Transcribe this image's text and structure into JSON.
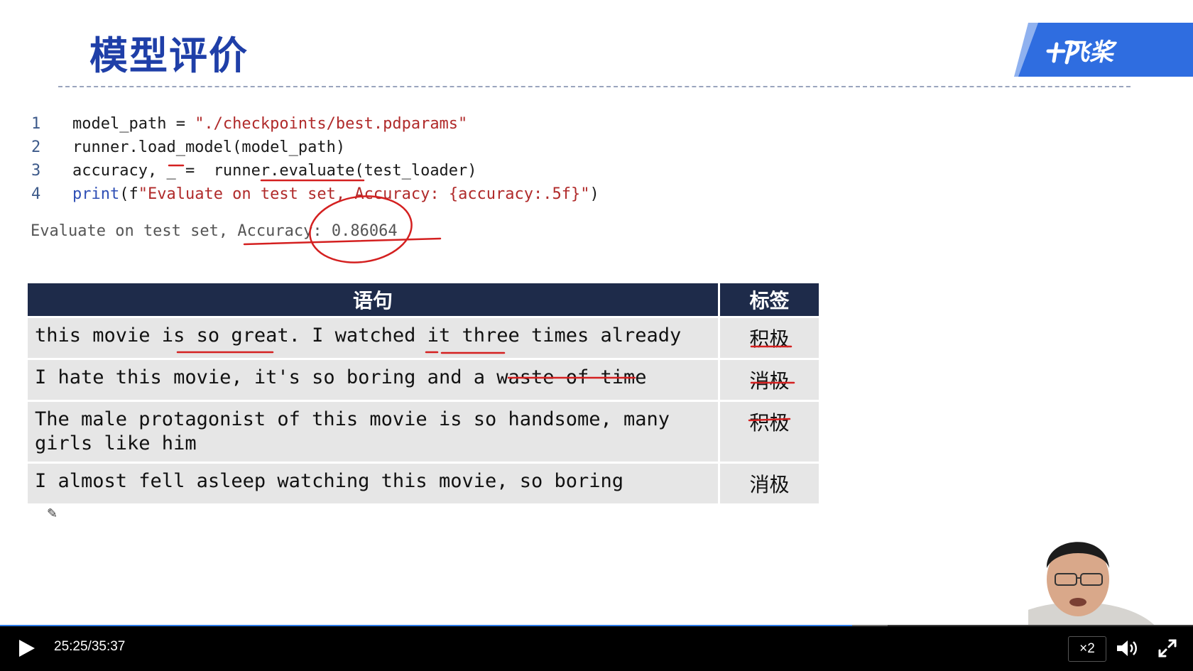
{
  "slide": {
    "title": "模型评价",
    "logo_text": "飞桨",
    "code": [
      {
        "num": "1",
        "parts": [
          {
            "t": "model_path = ",
            "c": "code-text"
          },
          {
            "t": "\"./checkpoints/best.pdparams\"",
            "c": "str"
          }
        ]
      },
      {
        "num": "2",
        "parts": [
          {
            "t": "runner.load_model(model_path)",
            "c": "code-text"
          }
        ]
      },
      {
        "num": "3",
        "parts": [
          {
            "t": "accuracy, _ =  runner.evaluate(test_loader)",
            "c": "code-text"
          }
        ]
      },
      {
        "num": "4",
        "parts": [
          {
            "t": "print",
            "c": "kw"
          },
          {
            "t": "(f",
            "c": "code-text"
          },
          {
            "t": "\"Evaluate on test set, Accuracy: {accuracy:.5f}\"",
            "c": "str"
          },
          {
            "t": ")",
            "c": "code-text"
          }
        ]
      }
    ],
    "output": "Evaluate on test set, Accuracy: 0.86064",
    "table": {
      "headers": [
        "语句",
        "标签"
      ],
      "rows": [
        {
          "sentence": "this movie is so great. I watched it three times already",
          "label": "积极"
        },
        {
          "sentence": "I hate this movie, it's so boring and a waste of time",
          "label": "消极"
        },
        {
          "sentence": "The male protagonist of this movie is so handsome, many girls like him",
          "label": "积极"
        },
        {
          "sentence": "I almost fell asleep watching this movie, so boring",
          "label": "消极"
        }
      ]
    }
  },
  "player": {
    "current_time": "25:25",
    "separator": "/",
    "duration": "35:37",
    "progress": 0.714,
    "buffered": 0.744,
    "speed_label": "×2",
    "play_icon": "play-icon",
    "volume_icon": "volume-icon",
    "fullscreen_icon": "fullscreen-icon",
    "progress_color": "#2d7be6"
  }
}
